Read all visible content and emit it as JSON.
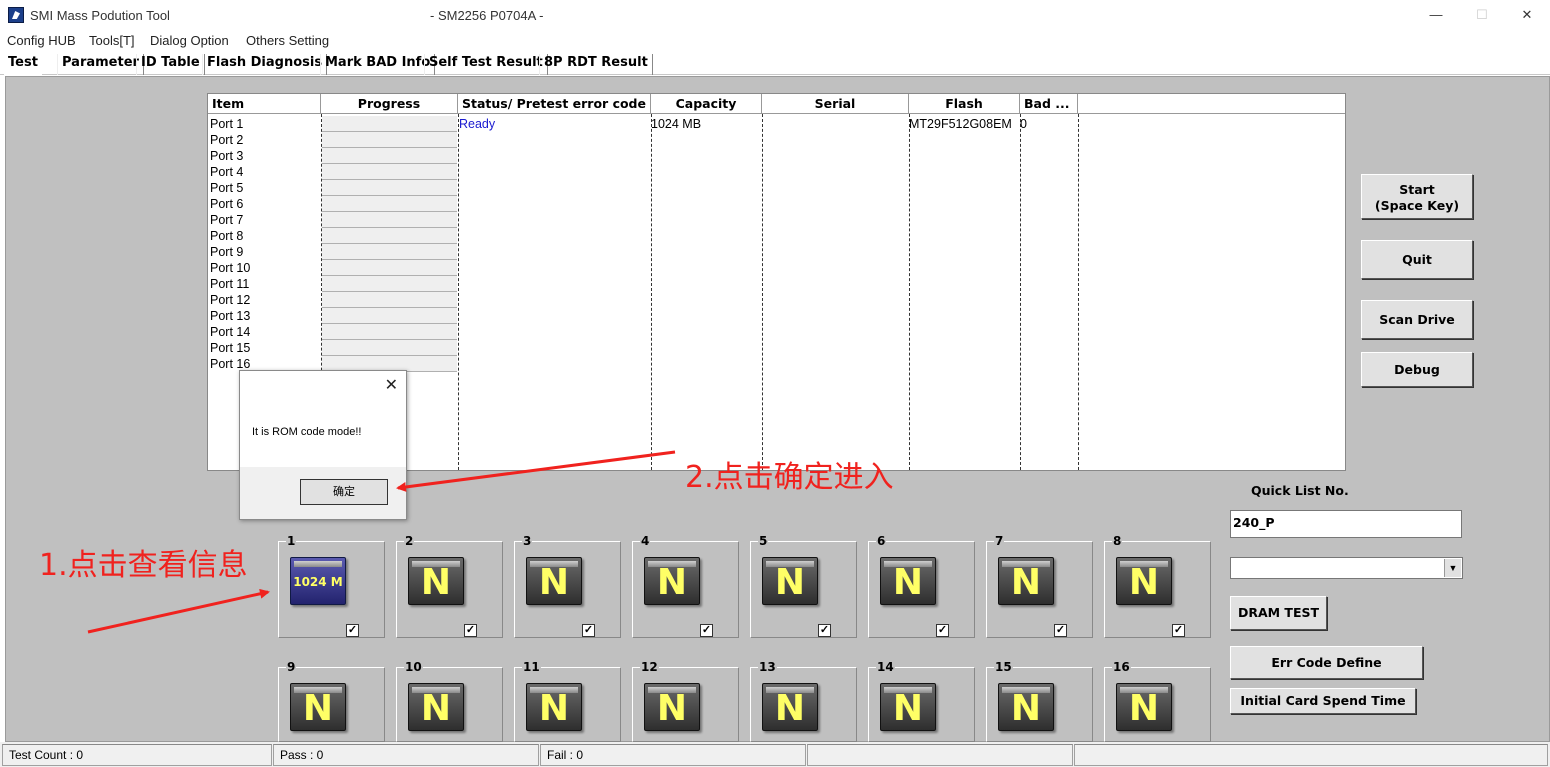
{
  "window": {
    "title": "SMI Mass Podution Tool",
    "subtitle": "- SM2256 P0704A -",
    "minimize": "—",
    "maximize": "☐",
    "close": "✕"
  },
  "menu": [
    "Config HUB",
    "Tools[T]",
    "Dialog Option",
    "Others Setting"
  ],
  "tabs": [
    "Test",
    "Parameter",
    "ID Table",
    "Flash Diagnosis",
    "Mark BAD Info",
    "Self Test Result",
    "8P RDT Result"
  ],
  "table": {
    "headers": [
      "Item",
      "Progress",
      "Status/ Pretest error code",
      "Capacity",
      "Serial",
      "Flash",
      "Bad ..."
    ],
    "ports": [
      "Port 1",
      "Port 2",
      "Port 3",
      "Port 4",
      "Port 5",
      "Port 6",
      "Port 7",
      "Port 8",
      "Port 9",
      "Port 10",
      "Port 11",
      "Port 12",
      "Port 13",
      "Port 14",
      "Port 15",
      "Port 16"
    ],
    "row1": {
      "status": "Ready",
      "capacity": "1024 MB",
      "flash": "MT29F512G08EM",
      "bad": "0"
    },
    "status_color": "#1a1ad0"
  },
  "dialog": {
    "message": "It is ROM code mode!!",
    "ok": "确定",
    "close": "✕"
  },
  "buttons": {
    "start_line1": "Start",
    "start_line2": "(Space Key)",
    "quit": "Quit",
    "scan": "Scan Drive",
    "debug": "Debug",
    "dram": "DRAM TEST",
    "err_code": "Err Code Define",
    "initial_card": "Initial Card Spend Time"
  },
  "quick_list": {
    "label": "Quick List No.",
    "value": "240_P"
  },
  "ports_panel": {
    "nums": [
      "1",
      "2",
      "3",
      "4",
      "5",
      "6",
      "7",
      "8",
      "9",
      "10",
      "11",
      "12",
      "13",
      "14",
      "15",
      "16"
    ],
    "port1_label": "1024 M",
    "empty_letter": "N",
    "checkmark": "✓"
  },
  "annotations": {
    "step1": "1.点击查看信息",
    "step2": "2.点击确定进入",
    "color": "#f0221e"
  },
  "status_bar": {
    "test_count": "Test Count : 0",
    "pass": "Pass : 0",
    "fail": "Fail : 0"
  }
}
